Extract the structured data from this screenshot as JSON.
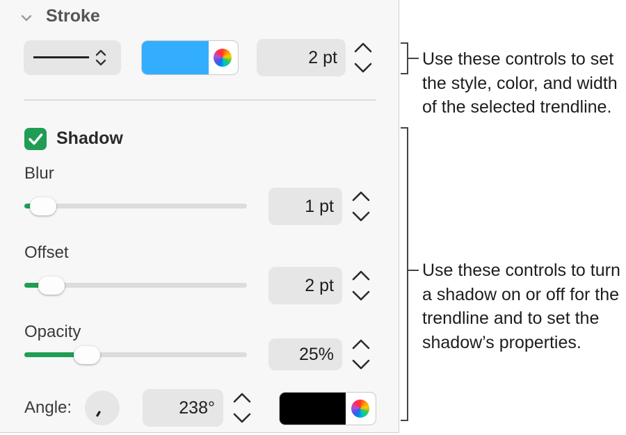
{
  "stroke": {
    "title": "Stroke",
    "width_value": "2 pt",
    "color_hex": "#33AEFF"
  },
  "shadow": {
    "title": "Shadow",
    "checked": true,
    "blur": {
      "label": "Blur",
      "value": "1 pt",
      "level": 0.03
    },
    "offset": {
      "label": "Offset",
      "value": "2 pt",
      "level": 0.07
    },
    "opacity": {
      "label": "Opacity",
      "value": "25%",
      "level": 0.25
    },
    "angle": {
      "label": "Angle:",
      "value": "238°"
    },
    "color_hex": "#000000"
  },
  "callouts": {
    "stroke_text": "Use these controls to set the style, color, and width of the selected trendline.",
    "shadow_text": "Use these controls to turn a shadow on or off for the trendline and to set the shadow’s properties."
  },
  "colors": {
    "accent_green": "#1F9D55",
    "panel_bg": "#F7F7F7"
  }
}
